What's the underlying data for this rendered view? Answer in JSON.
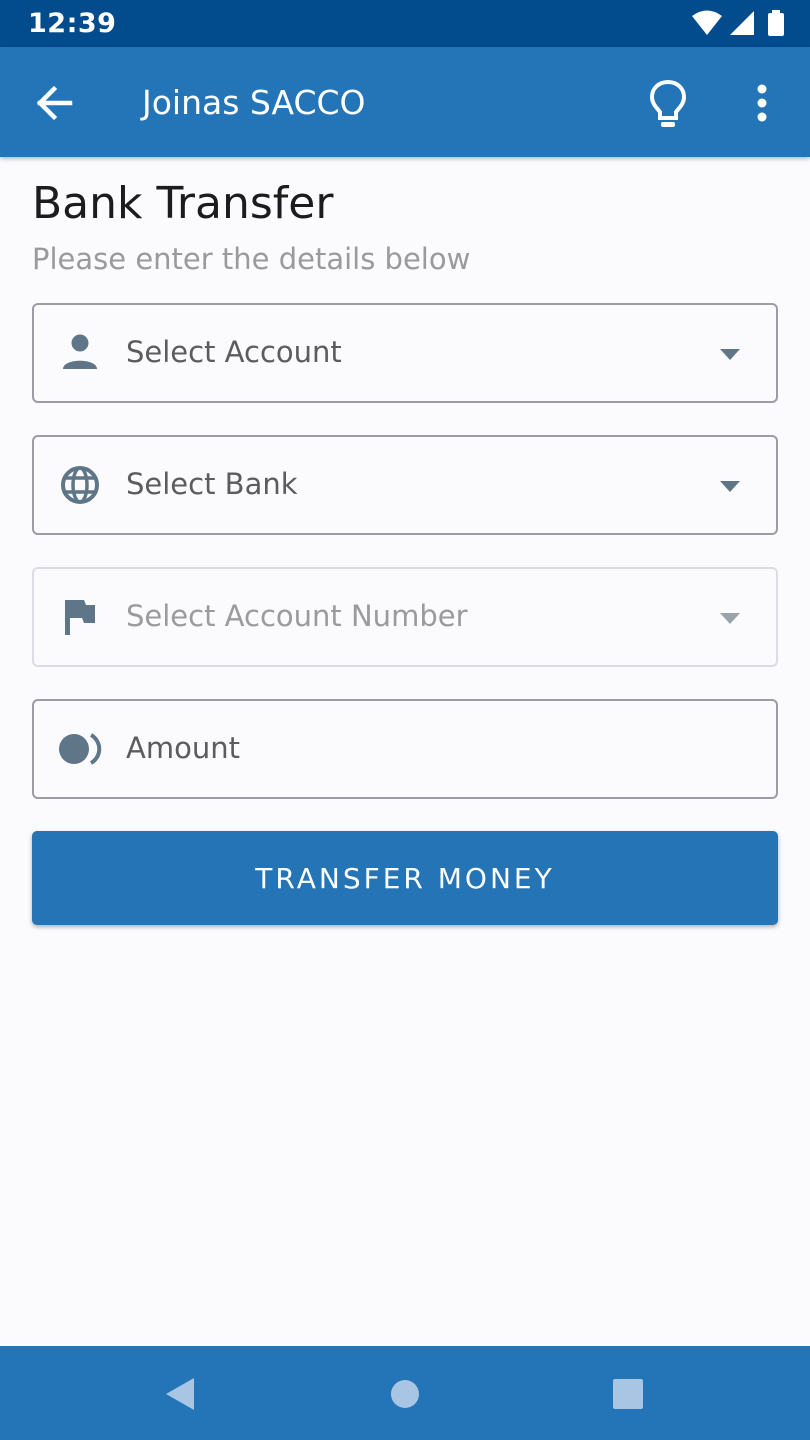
{
  "status_bar": {
    "time": "12:39",
    "icons": [
      "wifi-icon",
      "signal-icon",
      "battery-icon"
    ]
  },
  "app_bar": {
    "title": "Joinas SACCO",
    "back_icon": "arrow-left-icon",
    "tip_icon": "lightbulb-icon",
    "menu_icon": "more-vert-icon"
  },
  "page": {
    "title": "Bank Transfer",
    "subtitle": "Please enter the details below"
  },
  "form": {
    "account_select": {
      "placeholder": "Select Account",
      "icon": "person-icon"
    },
    "bank_select": {
      "placeholder": "Select Bank",
      "icon": "globe-icon"
    },
    "account_number_select": {
      "placeholder": "Select Account Number",
      "icon": "flag-icon",
      "enabled": false
    },
    "amount_input": {
      "placeholder": "Amount",
      "icon": "toll-icon"
    },
    "submit_label": "TRANSFER MONEY"
  },
  "nav_bar": {
    "icons": [
      "back-triangle-icon",
      "home-circle-icon",
      "recents-square-icon"
    ]
  },
  "colors": {
    "status_bar": "#024b8c",
    "app_bar": "#2375b8",
    "primary_button": "#2474b6",
    "icon": "#5e7687"
  }
}
